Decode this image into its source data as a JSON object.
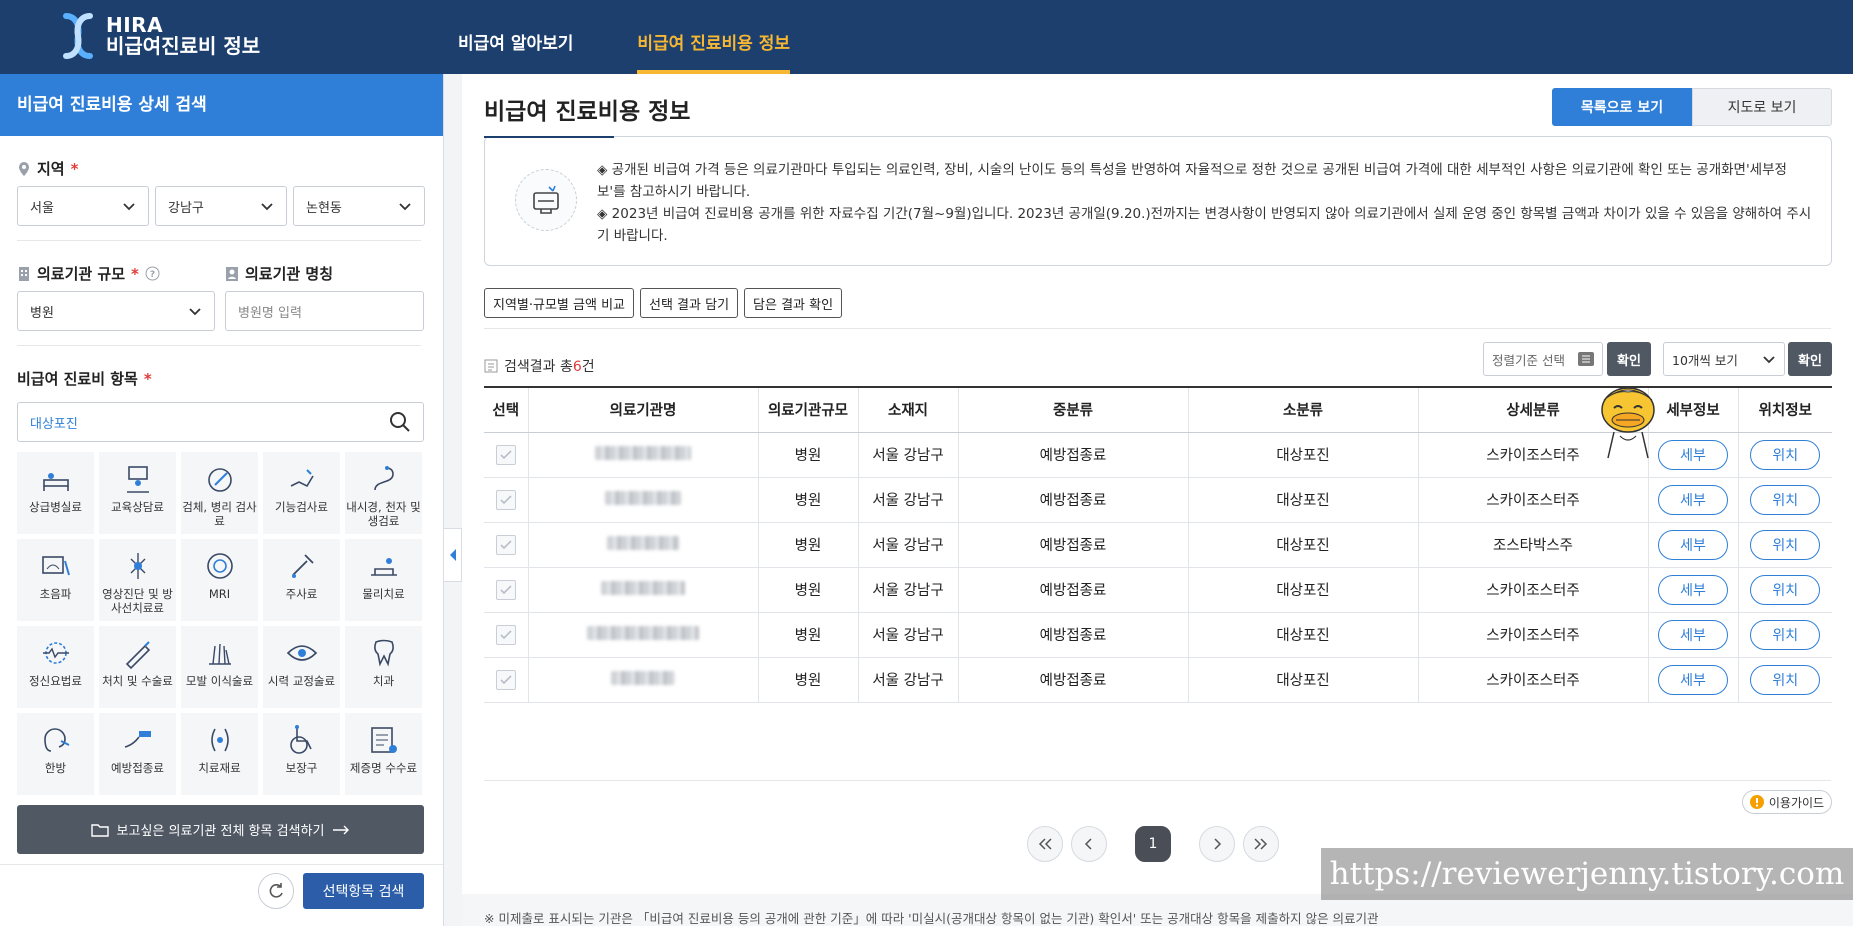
{
  "header": {
    "logo_line1": "HIRA",
    "logo_line2": "비급여진료비 정보",
    "nav": [
      "비급여 알아보기",
      "비급여 진료비용 정보"
    ]
  },
  "sidebar": {
    "title": "비급여 진료비용 상세 검색",
    "region_label": "지역",
    "region_selects": [
      "서울",
      "강남구",
      "논현동"
    ],
    "scale_label": "의료기관 규모",
    "scale_value": "병원",
    "name_label": "의료기관 명칭",
    "name_placeholder": "병원명 입력",
    "items_label": "비급여 진료비 항목",
    "items_search_value": "대상포진",
    "tiles": [
      {
        "label": "상급병실료",
        "icon": "bed-icon"
      },
      {
        "label": "교육상담료",
        "icon": "counseling-icon"
      },
      {
        "label": "검체, 병리 검사료",
        "icon": "specimen-icon"
      },
      {
        "label": "기능검사료",
        "icon": "function-test-icon"
      },
      {
        "label": "내시경, 천자 및 생검료",
        "icon": "endoscope-icon"
      },
      {
        "label": "초음파",
        "icon": "ultrasound-icon"
      },
      {
        "label": "영상진단 및 방사선치료료",
        "icon": "radiology-icon"
      },
      {
        "label": "MRI",
        "icon": "mri-icon"
      },
      {
        "label": "주사료",
        "icon": "syringe-icon"
      },
      {
        "label": "물리치료",
        "icon": "physio-icon"
      },
      {
        "label": "정신요법료",
        "icon": "brain-icon"
      },
      {
        "label": "처치 및 수술료",
        "icon": "surgery-icon"
      },
      {
        "label": "모발 이식술료",
        "icon": "hair-icon"
      },
      {
        "label": "시력 교정술료",
        "icon": "eye-icon"
      },
      {
        "label": "치과",
        "icon": "tooth-icon"
      },
      {
        "label": "한방",
        "icon": "ear-icon"
      },
      {
        "label": "예방접종료",
        "icon": "vaccine-icon"
      },
      {
        "label": "치료재료",
        "icon": "material-icon"
      },
      {
        "label": "보장구",
        "icon": "wheelchair-icon"
      },
      {
        "label": "제증명 수수료",
        "icon": "certificate-icon"
      }
    ],
    "all_search_label": "보고싶은 의료기관 전체 항목 검색하기",
    "search_button": "선택항목 검색"
  },
  "main": {
    "title": "비급여 진료비용 정보",
    "view_list": "목록으로 보기",
    "view_map": "지도로 보기",
    "notice_1": "◈ 공개된 비급여 가격 등은 의료기관마다 투입되는 의료인력, 장비, 시술의 난이도 등의 특성을 반영하여 자율적으로 정한 것으로 공개된 비급여 가격에 대한 세부적인 사항은 의료기관에 확인 또는 공개화면'세부정보'를 참고하시기 바랍니다.",
    "notice_2": "◈ 2023년 비급여 진료비용 공개를 위한 자료수집 기간(7월~9월)입니다. 2023년 공개일(9.20.)전까지는 변경사항이 반영되지 않아 의료기관에서 실제 운영 중인 항목별 금액과 차이가 있을 수 있음을 양해하여 주시기 바랍니다.",
    "buttons": [
      "지역별·규모별 금액 비교",
      "선택 결과 담기",
      "담은 결과 확인"
    ],
    "result_prefix": "검색결과 총",
    "result_count": "6",
    "result_suffix": "건",
    "sort_placeholder": "정렬기준 선택",
    "confirm": "확인",
    "per_page": "10개씩 보기",
    "columns": [
      "선택",
      "의료기관명",
      "의료기관규모",
      "소재지",
      "중분류",
      "소분류",
      "상세분류",
      "세부정보",
      "위치정보"
    ],
    "rows": [
      {
        "scale": "병원",
        "location": "서울 강남구",
        "mid": "예방접종료",
        "small": "대상포진",
        "detail": "스카이조스터주",
        "btn_detail": "세부",
        "btn_loc": "위치"
      },
      {
        "scale": "병원",
        "location": "서울 강남구",
        "mid": "예방접종료",
        "small": "대상포진",
        "detail": "스카이조스터주",
        "btn_detail": "세부",
        "btn_loc": "위치"
      },
      {
        "scale": "병원",
        "location": "서울 강남구",
        "mid": "예방접종료",
        "small": "대상포진",
        "detail": "조스타박스주",
        "btn_detail": "세부",
        "btn_loc": "위치"
      },
      {
        "scale": "병원",
        "location": "서울 강남구",
        "mid": "예방접종료",
        "small": "대상포진",
        "detail": "스카이조스터주",
        "btn_detail": "세부",
        "btn_loc": "위치"
      },
      {
        "scale": "병원",
        "location": "서울 강남구",
        "mid": "예방접종료",
        "small": "대상포진",
        "detail": "스카이조스터주",
        "btn_detail": "세부",
        "btn_loc": "위치"
      },
      {
        "scale": "병원",
        "location": "서울 강남구",
        "mid": "예방접종료",
        "small": "대상포진",
        "detail": "스카이조스터주",
        "btn_detail": "세부",
        "btn_loc": "위치"
      }
    ],
    "guide": "이용가이드",
    "current_page": "1",
    "footnote": "※ 미제출로 표시되는 기관은 「비급여 진료비용 등의 공개에 관한 기준」에 따라 '미실시(공개대상 항목이 없는 기관) 확인서' 또는 공개대상 항목을 제출하지 않은 의료기관"
  },
  "watermark": "https://reviewerjenny.tistory.com",
  "colors": {
    "brand": "#1d3f6e",
    "accent": "#2f7fd9",
    "highlight": "#f7b733",
    "required": "#e23b3b"
  }
}
